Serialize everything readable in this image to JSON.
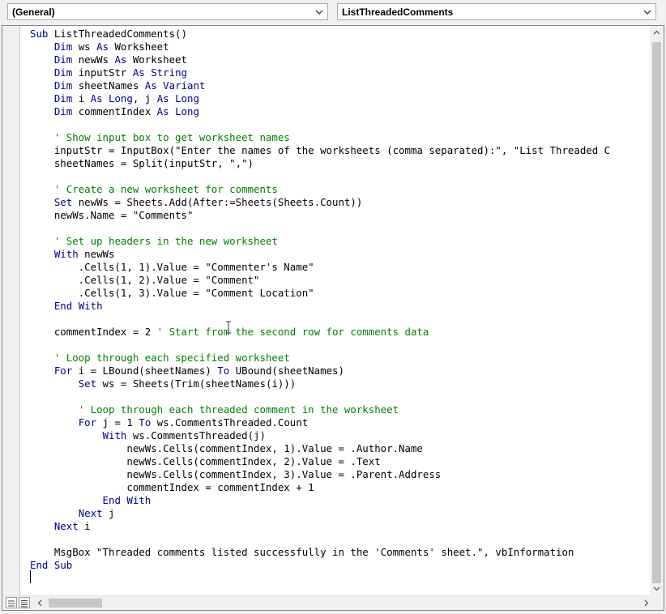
{
  "procedure_bar": {
    "object_value": "(General)",
    "procedure_value": "ListThreadedComments"
  },
  "icons": {
    "dropdown": "chevron-down-icon",
    "scroll_up": "arrow-up-icon",
    "scroll_down": "arrow-down-icon",
    "scroll_left": "arrow-left-icon",
    "scroll_right": "arrow-right-icon",
    "procedure_view": "procedure-view-icon",
    "module_view": "full-module-view-icon"
  },
  "colors": {
    "keyword": "#00008b",
    "comment": "#008000",
    "text": "#000000"
  },
  "code": [
    "Sub ListThreadedComments()",
    "    Dim ws As Worksheet",
    "    Dim newWs As Worksheet",
    "    Dim inputStr As String",
    "    Dim sheetNames As Variant",
    "    Dim i As Long, j As Long",
    "    Dim commentIndex As Long",
    "",
    "    ' Show input box to get worksheet names",
    "    inputStr = InputBox(\"Enter the names of the worksheets (comma separated):\", \"List Threaded C",
    "    sheetNames = Split(inputStr, \",\")",
    "",
    "    ' Create a new worksheet for comments",
    "    Set newWs = Sheets.Add(After:=Sheets(Sheets.Count))",
    "    newWs.Name = \"Comments\"",
    "",
    "    ' Set up headers in the new worksheet",
    "    With newWs",
    "        .Cells(1, 1).Value = \"Commenter's Name\"",
    "        .Cells(1, 2).Value = \"Comment\"",
    "        .Cells(1, 3).Value = \"Comment Location\"",
    "    End With",
    "",
    "    commentIndex = 2 ' Start from the second row for comments data",
    "",
    "    ' Loop through each specified worksheet",
    "    For i = LBound(sheetNames) To UBound(sheetNames)",
    "        Set ws = Sheets(Trim(sheetNames(i)))",
    "",
    "        ' Loop through each threaded comment in the worksheet",
    "        For j = 1 To ws.CommentsThreaded.Count",
    "            With ws.CommentsThreaded(j)",
    "                newWs.Cells(commentIndex, 1).Value = .Author.Name",
    "                newWs.Cells(commentIndex, 2).Value = .Text",
    "                newWs.Cells(commentIndex, 3).Value = .Parent.Address",
    "                commentIndex = commentIndex + 1",
    "            End With",
    "        Next j",
    "    Next i",
    "",
    "    MsgBox \"Threaded comments listed successfully in the 'Comments' sheet.\", vbInformation",
    "End Sub",
    ""
  ]
}
